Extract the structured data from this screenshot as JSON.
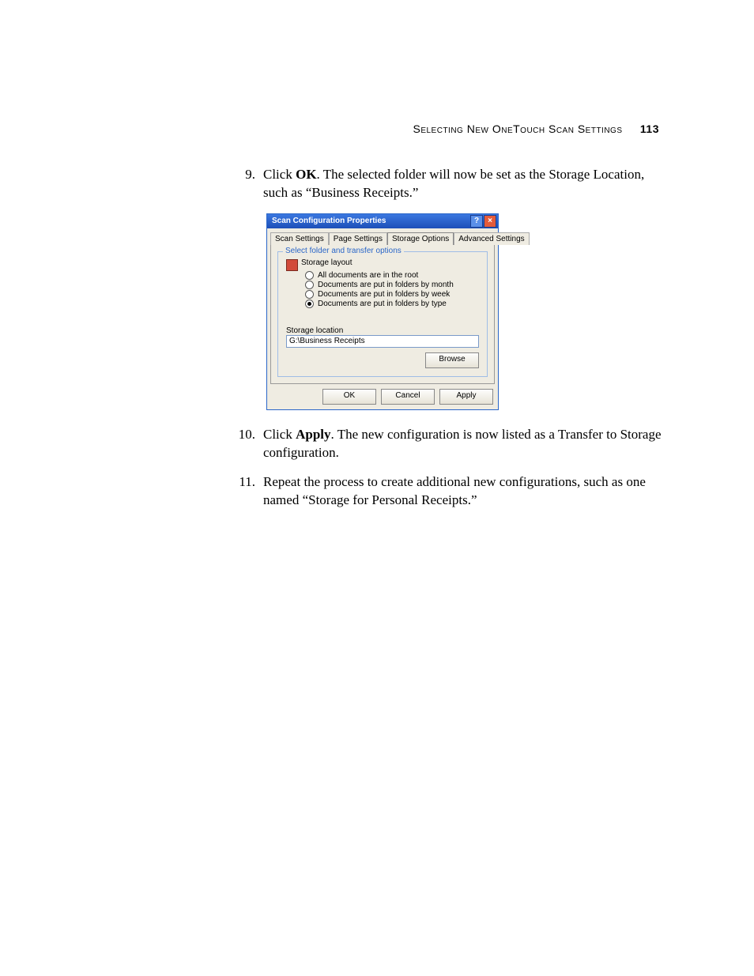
{
  "header": {
    "section_title": "Selecting New OneTouch Scan Settings",
    "page_number": "113"
  },
  "steps": [
    {
      "num": "9.",
      "prefix": "Click ",
      "bold": "OK",
      "rest": ". The selected folder will now be set as the Storage Location, such as “Business Receipts.”"
    },
    {
      "num": "10.",
      "prefix": "Click ",
      "bold": "Apply",
      "rest": ". The new configuration is now listed as a Transfer to Storage configuration."
    },
    {
      "num": "11.",
      "prefix": "",
      "bold": "",
      "rest": "Repeat the process to create additional new configurations, such as one named “Storage for Personal Receipts.”"
    }
  ],
  "dialog": {
    "title": "Scan Configuration Properties",
    "help_label": "?",
    "close_label": "×",
    "tabs": [
      "Scan Settings",
      "Page Settings",
      "Storage Options",
      "Advanced Settings"
    ],
    "active_tab_index": 2,
    "group_title": "Select folder and transfer options",
    "storage_layout_label": "Storage layout",
    "radio_options": [
      {
        "label": "All documents are in the root",
        "selected": false
      },
      {
        "label": "Documents are put in folders by month",
        "selected": false
      },
      {
        "label": "Documents are put in folders by week",
        "selected": false
      },
      {
        "label": "Documents are put in folders by type",
        "selected": true
      }
    ],
    "storage_location_label": "Storage location",
    "storage_location_value": "G:\\Business Receipts",
    "browse_label": "Browse",
    "ok_label": "OK",
    "cancel_label": "Cancel",
    "apply_label": "Apply"
  }
}
